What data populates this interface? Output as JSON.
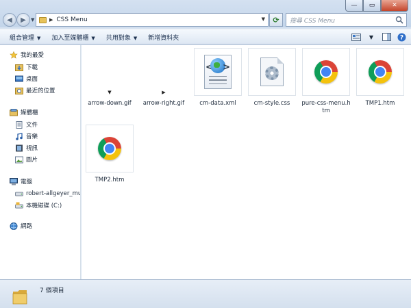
{
  "window": {
    "buttons": {
      "minimize": "—",
      "maximize": "▭",
      "close": "✕"
    }
  },
  "nav": {
    "back_icon": "back-arrow-icon",
    "forward_icon": "forward-arrow-icon",
    "breadcrumb": "CSS Menu",
    "search_placeholder": "搜尋 CSS Menu"
  },
  "toolbar": {
    "items": [
      "組合管理",
      "加入至媒體櫃",
      "共用對象",
      "新增資料夾"
    ]
  },
  "sidebar": {
    "favorites_label": "我的最愛",
    "favorites": [
      "下載",
      "桌面",
      "最近的位置"
    ],
    "libraries_label": "媒體櫃",
    "libraries": [
      "文件",
      "音樂",
      "視訊",
      "圖片"
    ],
    "computer_label": "電腦",
    "computer": [
      "robert-allgeyer_mu",
      "本機磁碟 (C:)"
    ],
    "network_label": "網路"
  },
  "files": [
    {
      "name": "arrow-down.gif",
      "icon": "arrow-down-gif-icon"
    },
    {
      "name": "arrow-right.gif",
      "icon": "arrow-right-gif-icon"
    },
    {
      "name": "cm-data.xml",
      "icon": "xml-file-icon"
    },
    {
      "name": "cm-style.css",
      "icon": "css-file-icon"
    },
    {
      "name": "pure-css-menu.htm",
      "icon": "chrome-icon"
    },
    {
      "name": "TMP1.htm",
      "icon": "chrome-icon"
    },
    {
      "name": "TMP2.htm",
      "icon": "chrome-icon"
    }
  ],
  "status": {
    "count": "7 個項目"
  },
  "colors": {
    "chrome_red": "#db4437",
    "chrome_yellow": "#f4c20d",
    "chrome_green": "#0f9d58",
    "chrome_blue": "#4285f4"
  }
}
